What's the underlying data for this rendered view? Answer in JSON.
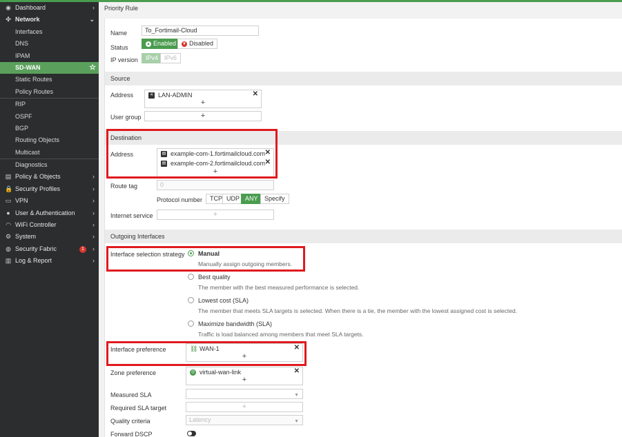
{
  "sidebar": {
    "items": [
      {
        "label": "Dashboard",
        "icon": "dashboard-icon",
        "glyph": "◉",
        "chevron": "›"
      },
      {
        "label": "Network",
        "icon": "network-icon",
        "glyph": "✣",
        "chevron": "⌄"
      },
      {
        "label": "Interfaces"
      },
      {
        "label": "DNS"
      },
      {
        "label": "IPAM"
      },
      {
        "label": "SD-WAN",
        "active": true
      },
      {
        "label": "Static Routes"
      },
      {
        "label": "Policy Routes"
      },
      {
        "label": "RIP"
      },
      {
        "label": "OSPF"
      },
      {
        "label": "BGP"
      },
      {
        "label": "Routing Objects"
      },
      {
        "label": "Multicast"
      },
      {
        "label": "Diagnostics"
      },
      {
        "label": "Policy & Objects",
        "icon": "policy-icon",
        "glyph": "▤",
        "chevron": "›"
      },
      {
        "label": "Security Profiles",
        "icon": "lock-icon",
        "glyph": "🔒",
        "chevron": "›"
      },
      {
        "label": "VPN",
        "icon": "monitor-icon",
        "glyph": "▭",
        "chevron": "›"
      },
      {
        "label": "User & Authentication",
        "icon": "user-icon",
        "glyph": "●",
        "chevron": "›"
      },
      {
        "label": "WiFi Controller",
        "icon": "wifi-icon",
        "glyph": "◠",
        "chevron": "›"
      },
      {
        "label": "System",
        "icon": "gear-icon",
        "glyph": "⚙",
        "chevron": "›"
      },
      {
        "label": "Security Fabric",
        "icon": "fabric-icon",
        "glyph": "◍",
        "chevron": "›",
        "badge": "1"
      },
      {
        "label": "Log & Report",
        "icon": "chart-icon",
        "glyph": "▥",
        "chevron": "›"
      }
    ],
    "star": "☆"
  },
  "page": {
    "title": "Priority Rule"
  },
  "form": {
    "name_label": "Name",
    "name_value": "To_Fortimail-Cloud",
    "status_label": "Status",
    "status_enabled": "Enabled",
    "status_disabled": "Disabled",
    "ipver_label": "IP version",
    "ipv4": "IPv4",
    "ipv6": "IPv6",
    "source_section": "Source",
    "address_label": "Address",
    "source_address": "LAN-ADMIN",
    "usergroup_label": "User group",
    "plus": "+",
    "remove": "✕",
    "destination_section": "Destination",
    "dest_address_1": "example-com-1.fortimailcloud.com",
    "dest_address_2": "example-com-2.fortimailcloud.com",
    "routetag_label": "Route tag",
    "routetag_value": "0",
    "protocol_label": "Protocol number",
    "protocols": [
      "TCP",
      "UDP",
      "ANY",
      "Specify"
    ],
    "protocol_selected": "ANY",
    "internet_service_label": "Internet service",
    "outgoing_section": "Outgoing Interfaces",
    "strategy_label": "Interface selection strategy",
    "strategies": [
      {
        "title": "Manual",
        "desc": "Manually assign outgoing members.",
        "checked": true
      },
      {
        "title": "Best quality",
        "desc": "The member with the best measured performance is selected."
      },
      {
        "title": "Lowest cost (SLA)",
        "desc": "The member that meets SLA targets is selected. When there is a tie, the member with the lowest assigned cost is selected."
      },
      {
        "title": "Maximize bandwidth (SLA)",
        "desc": "Traffic is load balanced among members that meet SLA targets."
      }
    ],
    "iface_pref_label": "Interface preference",
    "iface_pref_value": "WAN-1",
    "zone_pref_label": "Zone preference",
    "zone_pref_value": "virtual-wan-link",
    "measured_sla_label": "Measured SLA",
    "required_sla_label": "Required SLA target",
    "quality_label": "Quality criteria",
    "quality_value": "Latency",
    "dscp_label": "Forward DSCP"
  },
  "colors": {
    "accent": "#4a9c4e",
    "highlight": "#e0191e",
    "sidebar": "#2b2d2f"
  }
}
